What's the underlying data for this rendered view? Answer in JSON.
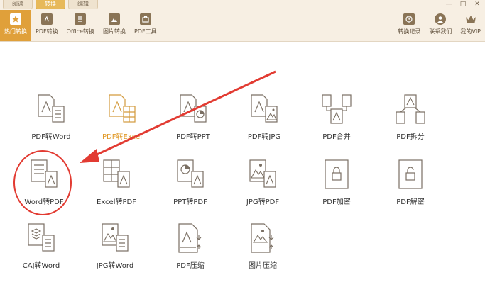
{
  "window": {
    "tabs": [
      "阅读",
      "转换",
      "编辑"
    ],
    "controls": [
      "—",
      "□",
      "✕"
    ]
  },
  "toolbar": {
    "left": [
      {
        "label": "热门转换",
        "icon": "star-icon",
        "active": true
      },
      {
        "label": "PDF转换",
        "icon": "pdf-file-icon"
      },
      {
        "label": "Office转换",
        "icon": "office-doc-icon"
      },
      {
        "label": "图片转换",
        "icon": "image-file-icon"
      },
      {
        "label": "PDF工具",
        "icon": "toolbox-icon"
      }
    ],
    "right": [
      {
        "label": "转换记录",
        "icon": "clock-icon"
      },
      {
        "label": "联系我们",
        "icon": "support-agent-icon"
      },
      {
        "label": "我的VIP",
        "icon": "crown-icon"
      }
    ]
  },
  "tools": [
    {
      "label": "PDF转Word",
      "icon": "pdf-to-word-icon"
    },
    {
      "label": "PDF转Excel",
      "icon": "pdf-to-excel-icon",
      "highlight": true
    },
    {
      "label": "PDF转PPT",
      "icon": "pdf-to-ppt-icon"
    },
    {
      "label": "PDF转JPG",
      "icon": "pdf-to-jpg-icon"
    },
    {
      "label": "PDF合并",
      "icon": "pdf-merge-icon"
    },
    {
      "label": "PDF拆分",
      "icon": "pdf-split-icon"
    },
    {
      "label": "Word转PDF",
      "icon": "word-to-pdf-icon"
    },
    {
      "label": "Excel转PDF",
      "icon": "excel-to-pdf-icon"
    },
    {
      "label": "PPT转PDF",
      "icon": "ppt-to-pdf-icon"
    },
    {
      "label": "JPG转PDF",
      "icon": "jpg-to-pdf-icon"
    },
    {
      "label": "PDF加密",
      "icon": "pdf-encrypt-icon"
    },
    {
      "label": "PDF解密",
      "icon": "pdf-decrypt-icon"
    },
    {
      "label": "CAJ转Word",
      "icon": "caj-to-word-icon"
    },
    {
      "label": "JPG转Word",
      "icon": "jpg-to-word-icon"
    },
    {
      "label": "PDF压缩",
      "icon": "pdf-compress-icon"
    },
    {
      "label": "图片压缩",
      "icon": "image-compress-icon"
    }
  ],
  "colors": {
    "accent": "#e0a03a",
    "annotation": "#e23b32",
    "icon_stroke": "#7a6f63"
  }
}
